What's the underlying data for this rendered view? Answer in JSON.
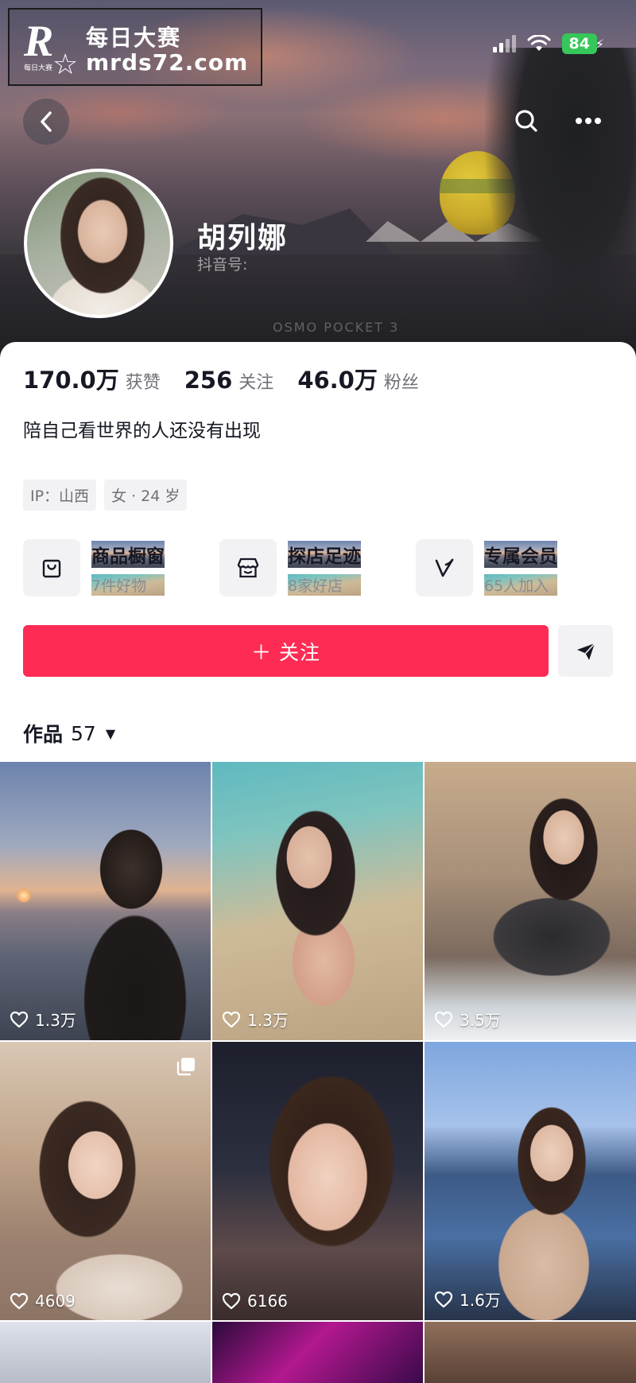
{
  "watermark": {
    "brand_cn": "每日大赛",
    "url": "mrds72.com",
    "logo_letter": "R",
    "logo_small": "每日大赛"
  },
  "status_bar": {
    "battery": "84"
  },
  "cover": {
    "camera_mark": "OSMO POCKET 3"
  },
  "profile": {
    "name": "胡列娜",
    "douyin_id_label": "抖音号:"
  },
  "stats": [
    {
      "value": "170.0万",
      "label": "获赞"
    },
    {
      "value": "256",
      "label": "关注"
    },
    {
      "value": "46.0万",
      "label": "粉丝"
    }
  ],
  "bio": "陪自己看世界的人还没有出现",
  "tags": [
    "IP：山西",
    "女 · 24 岁"
  ],
  "services": [
    {
      "title": "商品橱窗",
      "subtitle": "7件好物",
      "icon": "shopping-bag-icon"
    },
    {
      "title": "探店足迹",
      "subtitle": "8家好店",
      "icon": "store-icon"
    },
    {
      "title": "专属会员",
      "subtitle": "65人加入",
      "icon": "vip-icon"
    }
  ],
  "follow_button": "＋ 关注",
  "works": {
    "label": "作品",
    "count": "57"
  },
  "videos": [
    {
      "likes": "1.3万"
    },
    {
      "likes": "1.3万"
    },
    {
      "likes": "3.5万"
    },
    {
      "likes": "4609",
      "multi_image": true
    },
    {
      "likes": "6166"
    },
    {
      "likes": "1.6万"
    }
  ],
  "colors": {
    "accent": "#fe2c55",
    "text": "#161823",
    "muted": "#6f7077",
    "chip_bg": "#f2f2f4",
    "battery": "#35c759"
  }
}
